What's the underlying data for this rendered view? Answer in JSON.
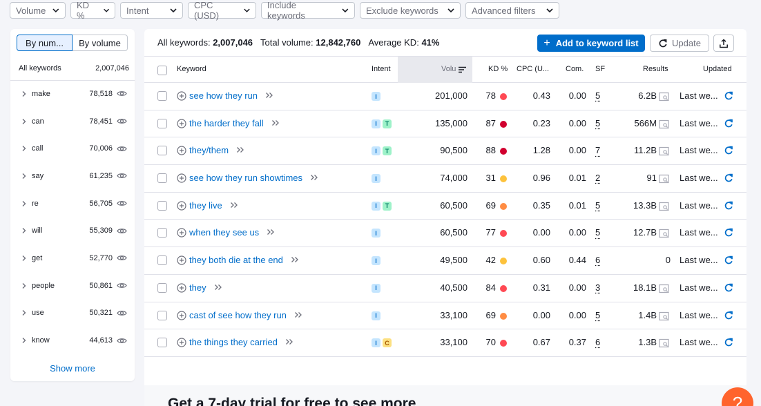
{
  "filters": [
    {
      "label": "Volume"
    },
    {
      "label": "KD %"
    },
    {
      "label": "Intent"
    },
    {
      "label": "CPC (USD)"
    },
    {
      "label": "Include keywords"
    },
    {
      "label": "Exclude keywords"
    },
    {
      "label": "Advanced filters"
    }
  ],
  "sidebar": {
    "toggle": {
      "by_number": "By num...",
      "by_volume": "By volume"
    },
    "header_label": "All keywords",
    "header_count": "2,007,046",
    "items": [
      {
        "label": "make",
        "count": "78,518"
      },
      {
        "label": "can",
        "count": "78,451"
      },
      {
        "label": "call",
        "count": "70,006"
      },
      {
        "label": "say",
        "count": "61,235"
      },
      {
        "label": "re",
        "count": "56,705"
      },
      {
        "label": "will",
        "count": "55,309"
      },
      {
        "label": "get",
        "count": "52,770"
      },
      {
        "label": "people",
        "count": "50,861"
      },
      {
        "label": "use",
        "count": "50,321"
      },
      {
        "label": "know",
        "count": "44,613"
      }
    ],
    "show_more": "Show more"
  },
  "summary": {
    "all_keywords_label": "All keywords:",
    "all_keywords_value": "2,007,046",
    "total_volume_label": "Total volume:",
    "total_volume_value": "12,842,760",
    "avg_kd_label": "Average KD:",
    "avg_kd_value": "41%"
  },
  "toolbar": {
    "add_label": "Add to keyword list",
    "update_label": "Update"
  },
  "columns": {
    "keyword": "Keyword",
    "intent": "Intent",
    "volume": "Volu",
    "kd": "KD %",
    "cpc": "CPC (U...",
    "com": "Com.",
    "sf": "SF",
    "results": "Results",
    "updated": "Updated"
  },
  "colors": {
    "accent": "#006dca",
    "kd_red_dark": "#d1002f",
    "kd_red": "#ff4953",
    "kd_orange": "#ff8c43",
    "kd_yellow": "#fdc23c",
    "help": "#ff642d"
  },
  "rows": [
    {
      "keyword": "see how they run",
      "intents": [
        "I"
      ],
      "volume": "201,000",
      "kd": "78",
      "kd_color": "#ff4953",
      "cpc": "0.43",
      "com": "0.00",
      "sf": "5",
      "results": "6.2B",
      "serp": true,
      "updated": "Last we..."
    },
    {
      "keyword": "the harder they fall",
      "intents": [
        "I",
        "T"
      ],
      "volume": "135,000",
      "kd": "87",
      "kd_color": "#d1002f",
      "cpc": "0.23",
      "com": "0.00",
      "sf": "5",
      "results": "566M",
      "serp": true,
      "updated": "Last we..."
    },
    {
      "keyword": "they/them",
      "intents": [
        "I",
        "T"
      ],
      "volume": "90,500",
      "kd": "88",
      "kd_color": "#d1002f",
      "cpc": "1.28",
      "com": "0.00",
      "sf": "7",
      "results": "11.2B",
      "serp": true,
      "updated": "Last we..."
    },
    {
      "keyword": "see how they run showtimes",
      "intents": [
        "I"
      ],
      "volume": "74,000",
      "kd": "31",
      "kd_color": "#fdc23c",
      "cpc": "0.96",
      "com": "0.01",
      "sf": "2",
      "results": "91",
      "serp": true,
      "updated": "Last we..."
    },
    {
      "keyword": "they live",
      "intents": [
        "I",
        "T"
      ],
      "volume": "60,500",
      "kd": "69",
      "kd_color": "#ff8c43",
      "cpc": "0.35",
      "com": "0.01",
      "sf": "5",
      "results": "13.3B",
      "serp": true,
      "updated": "Last we..."
    },
    {
      "keyword": "when they see us",
      "intents": [
        "I"
      ],
      "volume": "60,500",
      "kd": "77",
      "kd_color": "#ff4953",
      "cpc": "0.00",
      "com": "0.00",
      "sf": "5",
      "results": "12.7B",
      "serp": true,
      "updated": "Last we..."
    },
    {
      "keyword": "they both die at the end",
      "intents": [
        "I"
      ],
      "volume": "49,500",
      "kd": "42",
      "kd_color": "#fdc23c",
      "cpc": "0.60",
      "com": "0.44",
      "sf": "6",
      "results": "0",
      "serp": false,
      "updated": "Last we..."
    },
    {
      "keyword": "they",
      "intents": [
        "I"
      ],
      "volume": "40,500",
      "kd": "84",
      "kd_color": "#ff4953",
      "cpc": "0.31",
      "com": "0.00",
      "sf": "3",
      "results": "18.1B",
      "serp": true,
      "updated": "Last we..."
    },
    {
      "keyword": "cast of see how they run",
      "intents": [
        "I"
      ],
      "volume": "33,100",
      "kd": "69",
      "kd_color": "#ff8c43",
      "cpc": "0.00",
      "com": "0.00",
      "sf": "5",
      "results": "1.4B",
      "serp": true,
      "updated": "Last we..."
    },
    {
      "keyword": "the things they carried",
      "intents": [
        "I",
        "C"
      ],
      "volume": "33,100",
      "kd": "70",
      "kd_color": "#ff4953",
      "cpc": "0.67",
      "com": "0.37",
      "sf": "6",
      "results": "1.3B",
      "serp": true,
      "updated": "Last we..."
    }
  ],
  "promo": "Get a 7-day trial for free to see more",
  "help_label": "?"
}
